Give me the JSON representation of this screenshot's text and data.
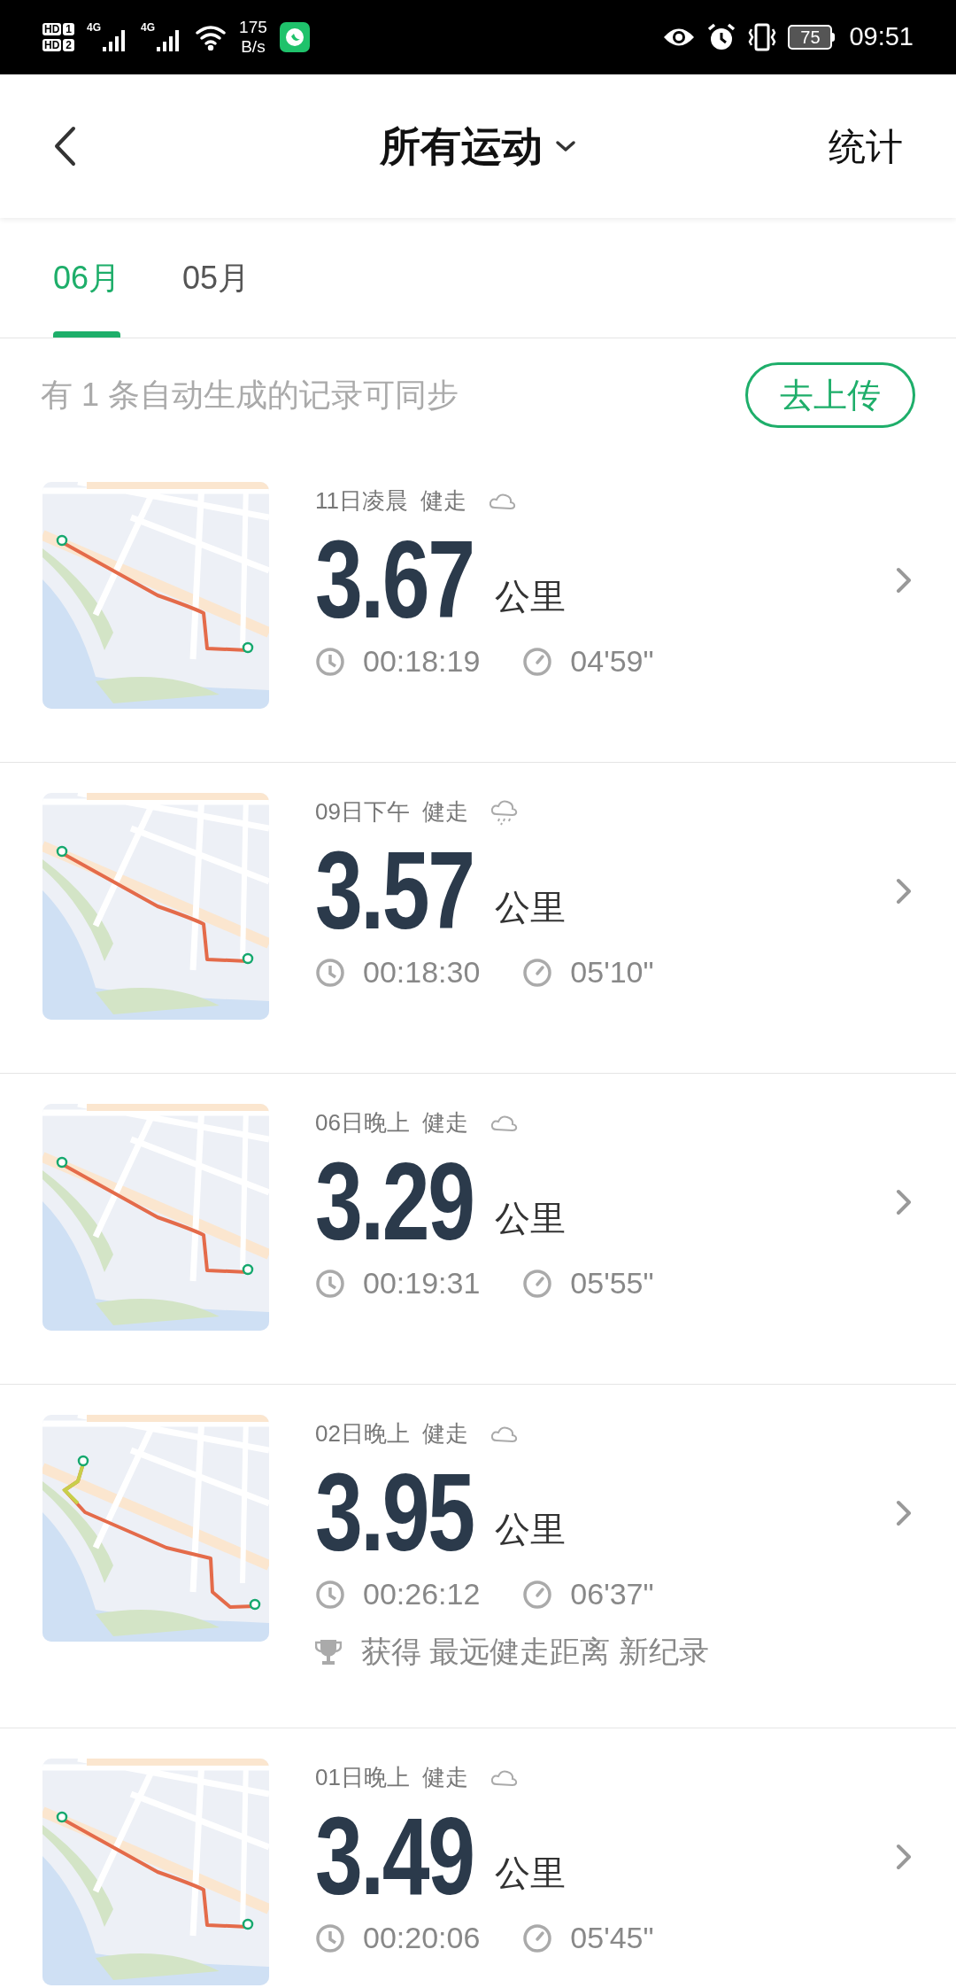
{
  "status_bar": {
    "sims": [
      {
        "hd": "HD",
        "slot": "1",
        "network": "4G"
      },
      {
        "hd": "HD",
        "slot": "2",
        "network": "4G"
      }
    ],
    "speed": "175",
    "speed_unit": "B/s",
    "battery": "75",
    "time": "09:51"
  },
  "header": {
    "title": "所有运动",
    "action": "统计"
  },
  "tabs": [
    {
      "label": "06月",
      "selected": true
    },
    {
      "label": "05月",
      "selected": false
    }
  ],
  "sync_banner": {
    "text": "有 1 条自动生成的记录可同步",
    "button": "去上传"
  },
  "records": [
    {
      "when": "11日凌晨",
      "sport": "健走",
      "rain": false,
      "distance": "3.67",
      "unit": "公里",
      "duration": "00:18:19",
      "pace": "04'59\""
    },
    {
      "when": "09日下午",
      "sport": "健走",
      "rain": true,
      "distance": "3.57",
      "unit": "公里",
      "duration": "00:18:30",
      "pace": "05'10\""
    },
    {
      "when": "06日晚上",
      "sport": "健走",
      "rain": false,
      "distance": "3.29",
      "unit": "公里",
      "duration": "00:19:31",
      "pace": "05'55\""
    },
    {
      "when": "02日晚上",
      "sport": "健走",
      "rain": false,
      "distance": "3.95",
      "unit": "公里",
      "duration": "00:26:12",
      "pace": "06'37\"",
      "achievement": "获得 最远健走距离 新纪录"
    },
    {
      "when": "01日晚上",
      "sport": "健走",
      "rain": false,
      "distance": "3.49",
      "unit": "公里",
      "duration": "00:20:06",
      "pace": "05'45\""
    }
  ]
}
